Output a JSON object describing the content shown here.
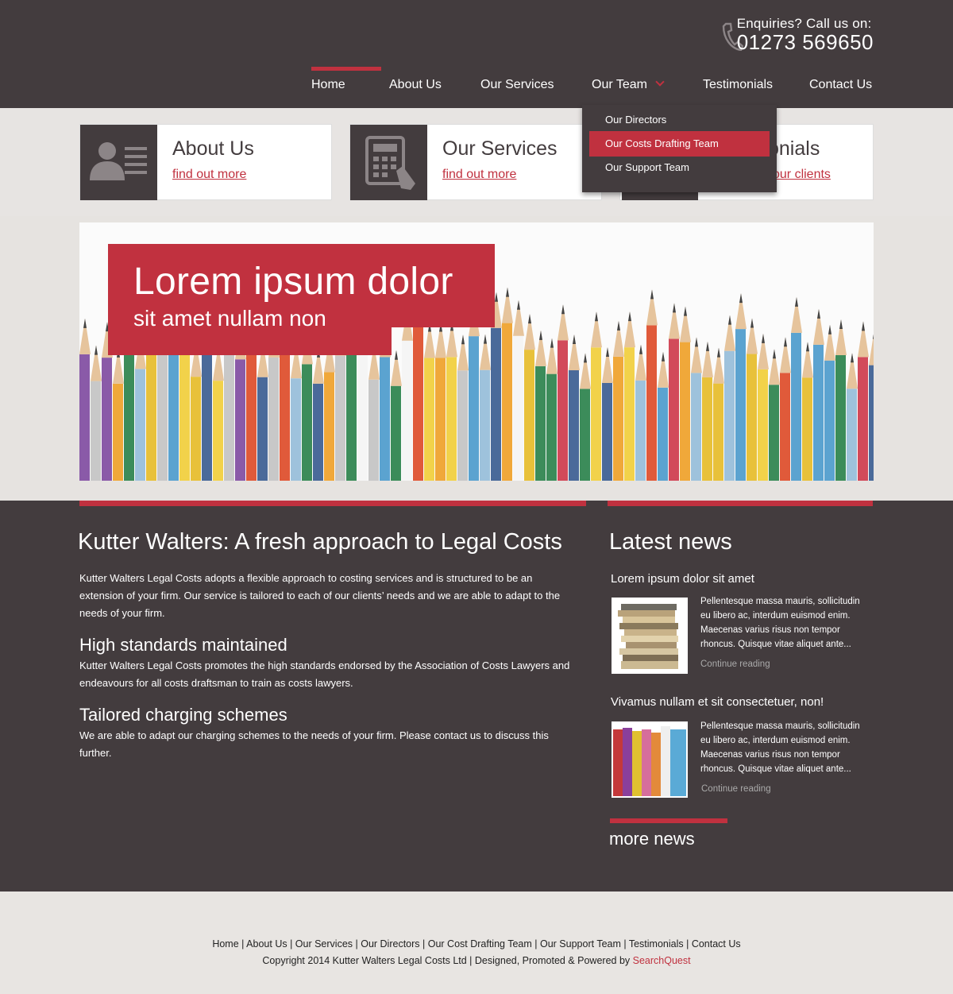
{
  "header": {
    "enquiries": "Enquiries?  Call us on:",
    "phone": "01273 569650"
  },
  "nav": [
    {
      "label": "Home"
    },
    {
      "label": "About Us"
    },
    {
      "label": "Our Services"
    },
    {
      "label": "Our Team"
    },
    {
      "label": "Testimonials"
    },
    {
      "label": "Contact Us"
    }
  ],
  "dropdown": [
    {
      "label": "Our Directors"
    },
    {
      "label": "Our Costs Drafting Team"
    },
    {
      "label": "Our Support Team"
    }
  ],
  "boxes": [
    {
      "title": "About Us",
      "link": "find out more",
      "icon": "person-card-icon"
    },
    {
      "title": "Our Services",
      "link": "find out more",
      "icon": "calculator-icon"
    },
    {
      "title": "onials",
      "link": "our clients"
    }
  ],
  "hero": {
    "title": "Lorem ipsum dolor",
    "subtitle": "sit amet nullam non"
  },
  "main": {
    "heading": "Kutter Walters: A fresh approach to Legal Costs",
    "intro": "Kutter Walters Legal Costs adopts a flexible approach to costing services and is structured to be an extension of your firm. Our service is tailored to each of our clients’ needs and we are able to adapt to the needs of your firm.",
    "h_standards": "High standards maintained",
    "p_standards": "Kutter Walters Legal Costs promotes the high standards endorsed by the Association of Costs Lawyers and endeavours for all costs draftsman to train as costs lawyers.",
    "h_charging": "Tailored charging schemes",
    "p_charging": "We are able to adapt our charging schemes to the needs of your firm. Please contact us to discuss this further."
  },
  "news": {
    "heading": "Latest news",
    "items": [
      {
        "title": "Lorem ipsum dolor sit amet",
        "text": "Pellentesque massa mauris, sollicitudin eu libero ac, interdum euismod enim. Maecenas varius risus non tempor rhoncus. Quisque vitae aliquet ante...",
        "more": "Continue reading"
      },
      {
        "title": "Vivamus nullam et sit consectetuer, non!",
        "text": "Pellentesque massa mauris, sollicitudin eu libero ac, interdum euismod enim. Maecenas varius risus non tempor rhoncus. Quisque vitae aliquet ante...",
        "more": "Continue reading"
      }
    ],
    "more": "more news"
  },
  "footer": {
    "links": "Home | About Us | Our Services | Our Directors | Our Cost Drafting Team | Our Support Team | Testimonials | Contact Us",
    "copyright": "Copyright 2014 Kutter Walters Legal Costs Ltd | Designed, Promoted & Powered by ",
    "credit": "SearchQuest"
  },
  "colors": {
    "dark": "#433c3e",
    "accent": "#c0313f",
    "light": "#e6e3e0"
  }
}
